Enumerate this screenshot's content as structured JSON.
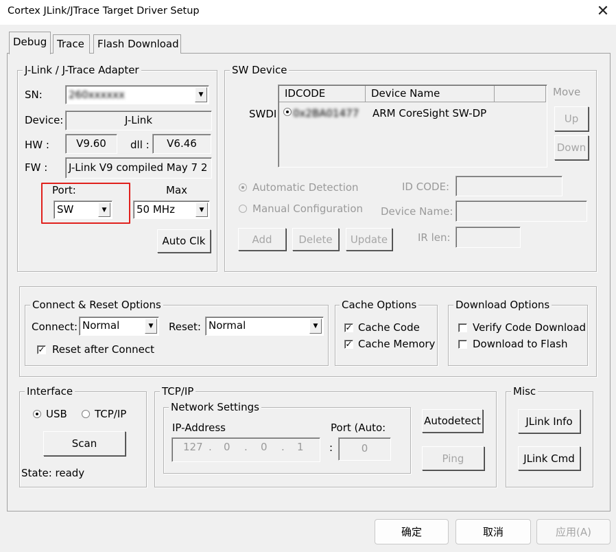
{
  "window": {
    "title": "Cortex JLink/JTrace Target Driver Setup",
    "close_glyph": "✕"
  },
  "tabs": [
    {
      "label": "Debug",
      "active": true
    },
    {
      "label": "Trace",
      "active": false
    },
    {
      "label": "Flash Download",
      "active": false
    }
  ],
  "adapter": {
    "group_label": "J-Link / J-Trace Adapter",
    "sn_label": "SN:",
    "sn_value": "260xxxxxx",
    "device_label": "Device:",
    "device_value": "J-Link",
    "hw_label": "HW :",
    "hw_value": "V9.60",
    "dll_label": "dll :",
    "dll_value": "V6.46",
    "fw_label": "FW :",
    "fw_value": "J-Link V9 compiled May  7 2",
    "port_label": "Port:",
    "port_value": "SW",
    "max_label": "Max",
    "max_value": "50 MHz",
    "auto_clk_label": "Auto Clk"
  },
  "sw_device": {
    "group_label": "SW Device",
    "row_header": "SWDI",
    "columns": [
      "IDCODE",
      "Device Name",
      ""
    ],
    "rows": [
      {
        "idcode": "0x2BA01477",
        "device_name": "ARM CoreSight SW-DP"
      }
    ],
    "move_label": "Move",
    "up_label": "Up",
    "down_label": "Down",
    "automatic_detection_label": "Automatic Detection",
    "manual_configuration_label": "Manual Configuration",
    "id_code_label": "ID CODE:",
    "device_name_label": "Device Name:",
    "ir_len_label": "IR len:",
    "add_label": "Add",
    "delete_label": "Delete",
    "update_label": "Update"
  },
  "connect_reset": {
    "group_label": "Connect & Reset Options",
    "connect_label": "Connect:",
    "connect_value": "Normal",
    "reset_label": "Reset:",
    "reset_value": "Normal",
    "reset_after_connect_label": "Reset after Connect",
    "reset_after_connect_checked": true
  },
  "cache_options": {
    "group_label": "Cache Options",
    "cache_code_label": "Cache Code",
    "cache_code_checked": true,
    "cache_memory_label": "Cache Memory",
    "cache_memory_checked": true
  },
  "download_options": {
    "group_label": "Download Options",
    "verify_label": "Verify Code Download",
    "verify_checked": false,
    "download_flash_label": "Download to Flash",
    "download_flash_checked": false
  },
  "interface": {
    "group_label": "Interface",
    "usb_label": "USB",
    "tcpip_label": "TCP/IP",
    "selected": "USB",
    "scan_label": "Scan",
    "state_text": "State: ready"
  },
  "tcpip": {
    "group_label": "TCP/IP",
    "network_label": "Network Settings",
    "ip_label": "IP-Address",
    "ip_octets": [
      "127",
      "0",
      "0",
      "1"
    ],
    "ip_dot": ".",
    "port_label": "Port (Auto:",
    "port_sep": ":",
    "port_value": "0",
    "autodetect_label": "Autodetect",
    "ping_label": "Ping"
  },
  "misc": {
    "group_label": "Misc",
    "jlink_info_label": "JLink Info",
    "jlink_cmd_label": "JLink Cmd"
  },
  "footer": {
    "ok_label": "确定",
    "cancel_label": "取消",
    "apply_label": "应用(A)"
  }
}
